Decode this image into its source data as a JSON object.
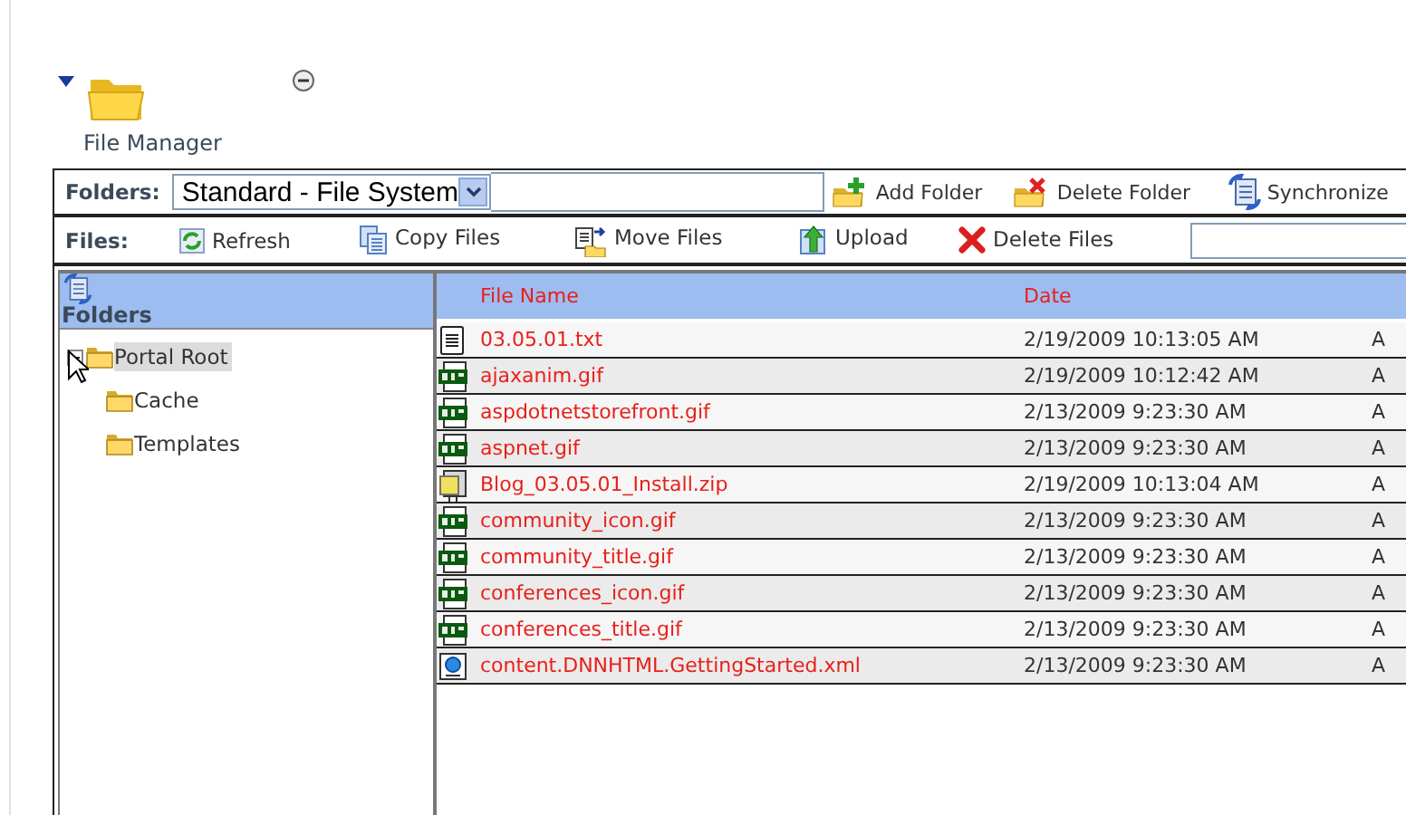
{
  "module": {
    "title": "File Manager"
  },
  "folders_bar": {
    "label": "Folders:",
    "storage_select": {
      "value": "Standard - File System"
    },
    "actions": [
      {
        "label": "Add Folder",
        "kind": "add-folder"
      },
      {
        "label": "Delete Folder",
        "kind": "delete-folder"
      },
      {
        "label": "Synchronize",
        "kind": "synchronize"
      }
    ]
  },
  "files_bar": {
    "label": "Files:",
    "actions": [
      {
        "label": "Refresh",
        "kind": "refresh"
      },
      {
        "label": "Copy Files",
        "kind": "copy"
      },
      {
        "label": "Move Files",
        "kind": "move"
      },
      {
        "label": "Upload",
        "kind": "upload"
      },
      {
        "label": "Delete Files",
        "kind": "delete"
      }
    ]
  },
  "folder_tree": {
    "title": "Folders",
    "items": [
      {
        "label": "Portal Root",
        "selected": true,
        "expanded": true,
        "children": [
          {
            "label": "Cache",
            "selected": false
          },
          {
            "label": "Templates",
            "selected": false
          }
        ]
      }
    ]
  },
  "file_list": {
    "columns": [
      "File Name",
      "Date"
    ],
    "rows": [
      {
        "kind": "txt",
        "name": "03.05.01.txt",
        "date": "2/19/2009 10:13:05 AM",
        "column_3": "A"
      },
      {
        "kind": "gif",
        "name": "ajaxanim.gif",
        "date": "2/19/2009 10:12:42 AM",
        "column_3": "A"
      },
      {
        "kind": "gif",
        "name": "aspdotnetstorefront.gif",
        "date": "2/13/2009 9:23:30 AM",
        "column_3": "A"
      },
      {
        "kind": "gif",
        "name": "aspnet.gif",
        "date": "2/13/2009 9:23:30 AM",
        "column_3": "A"
      },
      {
        "kind": "zip",
        "name": "Blog_03.05.01_Install.zip",
        "date": "2/19/2009 10:13:04 AM",
        "column_3": "A"
      },
      {
        "kind": "gif",
        "name": "community_icon.gif",
        "date": "2/13/2009 9:23:30 AM",
        "column_3": "A"
      },
      {
        "kind": "gif",
        "name": "community_title.gif",
        "date": "2/13/2009 9:23:30 AM",
        "column_3": "A"
      },
      {
        "kind": "gif",
        "name": "conferences_icon.gif",
        "date": "2/13/2009 9:23:30 AM",
        "column_3": "A"
      },
      {
        "kind": "gif",
        "name": "conferences_title.gif",
        "date": "2/13/2009 9:23:30 AM",
        "column_3": "A"
      },
      {
        "kind": "xml",
        "name": "content.DNNHTML.GettingStarted.xml",
        "date": "2/13/2009 9:23:30 AM",
        "column_3": "A"
      }
    ]
  }
}
